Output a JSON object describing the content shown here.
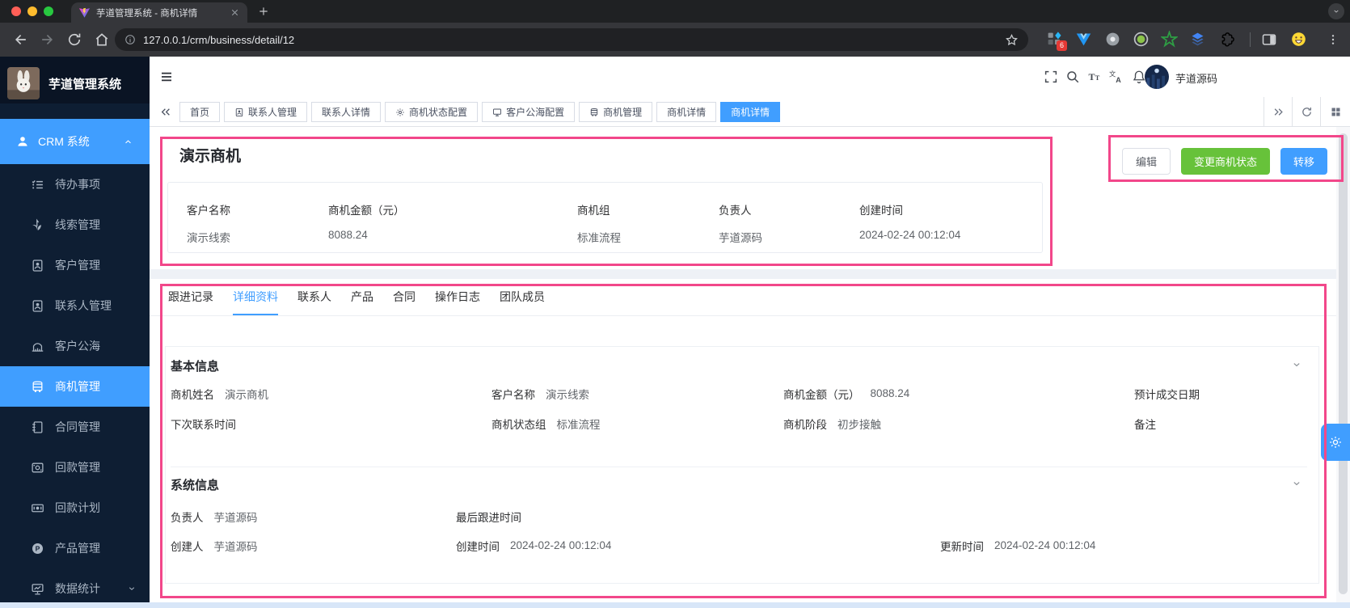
{
  "colors": {
    "accent": "#409eff",
    "success": "#67c23a",
    "annotation": "#f2478a",
    "sidebar_bg": "#0e1e33"
  },
  "browser": {
    "tab_title": "芋道管理系统 - 商机详情",
    "url": "127.0.0.1/crm/business/detail/12",
    "extension_badge": "6"
  },
  "sidebar": {
    "app_title": "芋道管理系统",
    "group": {
      "label": "CRM 系统"
    },
    "items": [
      {
        "label": "待办事项",
        "icon": "todo"
      },
      {
        "label": "线索管理",
        "icon": "clue"
      },
      {
        "label": "客户管理",
        "icon": "customer"
      },
      {
        "label": "联系人管理",
        "icon": "contact"
      },
      {
        "label": "客户公海",
        "icon": "sea"
      },
      {
        "label": "商机管理",
        "icon": "bus",
        "active": true
      },
      {
        "label": "合同管理",
        "icon": "contract"
      },
      {
        "label": "回款管理",
        "icon": "receivable"
      },
      {
        "label": "回款计划",
        "icon": "plan"
      },
      {
        "label": "产品管理",
        "icon": "product"
      },
      {
        "label": "数据统计",
        "icon": "stats",
        "chevron": "chev-down"
      }
    ]
  },
  "header": {
    "username": "芋道源码"
  },
  "tabbar": {
    "tabs": [
      {
        "label": "首页"
      },
      {
        "label": "联系人管理",
        "icon": "contact"
      },
      {
        "label": "联系人详情"
      },
      {
        "label": "商机状态配置",
        "icon": "status"
      },
      {
        "label": "客户公海配置",
        "icon": "seacfg"
      },
      {
        "label": "商机管理",
        "icon": "bus"
      },
      {
        "label": "商机详情"
      },
      {
        "label": "商机详情",
        "active": true
      }
    ]
  },
  "page": {
    "title": "演示商机",
    "actions": {
      "edit": "编辑",
      "change_status": "变更商机状态",
      "transfer": "转移"
    },
    "summary": [
      {
        "label": "客户名称",
        "value": "演示线索"
      },
      {
        "label": "商机金额（元）",
        "value": "8088.24"
      },
      {
        "label": "商机组",
        "value": "标准流程"
      },
      {
        "label": "负责人",
        "value": "芋道源码"
      },
      {
        "label": "创建时间",
        "value": "2024-02-24 00:12:04"
      }
    ],
    "detail_tabs": [
      {
        "label": "跟进记录"
      },
      {
        "label": "详细资料",
        "active": true
      },
      {
        "label": "联系人"
      },
      {
        "label": "产品"
      },
      {
        "label": "合同"
      },
      {
        "label": "操作日志"
      },
      {
        "label": "团队成员"
      }
    ],
    "basic_info": {
      "title": "基本信息",
      "fields": [
        {
          "label": "商机姓名",
          "value": "演示商机"
        },
        {
          "label": "客户名称",
          "value": "演示线索"
        },
        {
          "label": "商机金额（元）",
          "value": "8088.24"
        },
        {
          "label": "预计成交日期",
          "value": ""
        },
        {
          "label": "下次联系时间",
          "value": ""
        },
        {
          "label": "商机状态组",
          "value": "标准流程"
        },
        {
          "label": "商机阶段",
          "value": "初步接触"
        },
        {
          "label": "备注",
          "value": ""
        }
      ]
    },
    "system_info": {
      "title": "系统信息",
      "fields": [
        {
          "label": "负责人",
          "value": "芋道源码"
        },
        {
          "label": "最后跟进时间",
          "value": ""
        },
        {
          "label": "",
          "value": ""
        },
        {
          "label": "创建人",
          "value": "芋道源码"
        },
        {
          "label": "创建时间",
          "value": "2024-02-24 00:12:04"
        },
        {
          "label": "更新时间",
          "value": "2024-02-24 00:12:04"
        }
      ]
    }
  }
}
